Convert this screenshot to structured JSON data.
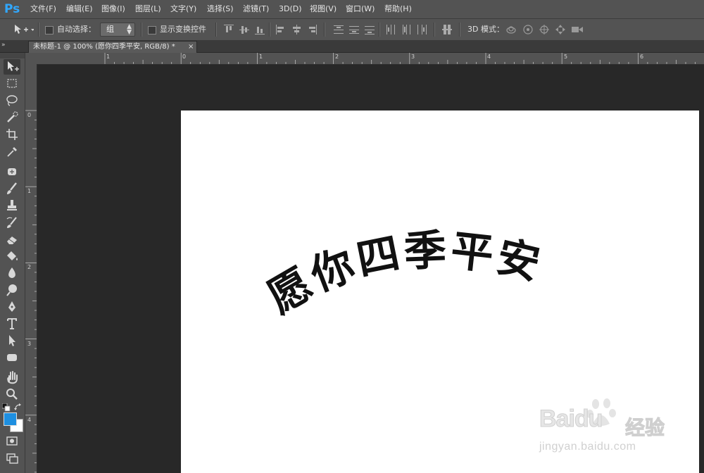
{
  "app": {
    "logo": "Ps"
  },
  "menu": [
    "文件(F)",
    "编辑(E)",
    "图像(I)",
    "图层(L)",
    "文字(Y)",
    "选择(S)",
    "滤镜(T)",
    "3D(D)",
    "视图(V)",
    "窗口(W)",
    "帮助(H)"
  ],
  "options": {
    "auto_select_label": "自动选择：",
    "auto_select_checked": false,
    "auto_select_value": "组",
    "show_transform_label": "显示变换控件",
    "show_transform_checked": false,
    "mode_3d_label": "3D 模式："
  },
  "tab": {
    "title": "未标题-1 @ 100% (愿你四季平安, RGB/8) *",
    "close": "×",
    "panel_toggle": "»"
  },
  "rulers": {
    "top": [
      "1",
      "0",
      "1",
      "2",
      "3",
      "4",
      "5",
      "6"
    ],
    "left": [
      "0",
      "1",
      "2",
      "3",
      "4"
    ]
  },
  "document": {
    "text": "愿你四季平安",
    "text_color": "#111111",
    "background": "#ffffff"
  },
  "colors": {
    "foreground": "#1e8fe0",
    "background": "#ffffff",
    "ui_bg": "#535353",
    "canvas_bg": "#282828",
    "accent": "#31a8ff"
  },
  "tools": [
    "move-icon",
    "marquee-icon",
    "lasso-icon",
    "quick-select-icon",
    "crop-icon",
    "eyedropper-icon",
    "healing-brush-icon",
    "brush-icon",
    "clone-stamp-icon",
    "history-brush-icon",
    "eraser-icon",
    "paint-bucket-icon",
    "blur-icon",
    "dodge-icon",
    "pen-icon",
    "type-icon",
    "path-select-icon",
    "shape-icon",
    "hand-icon",
    "zoom-icon",
    "quick-mask-icon",
    "screen-mode-icon"
  ],
  "watermark": {
    "brand": "Baidu",
    "product": "经验",
    "url": "jingyan.baidu.com"
  }
}
